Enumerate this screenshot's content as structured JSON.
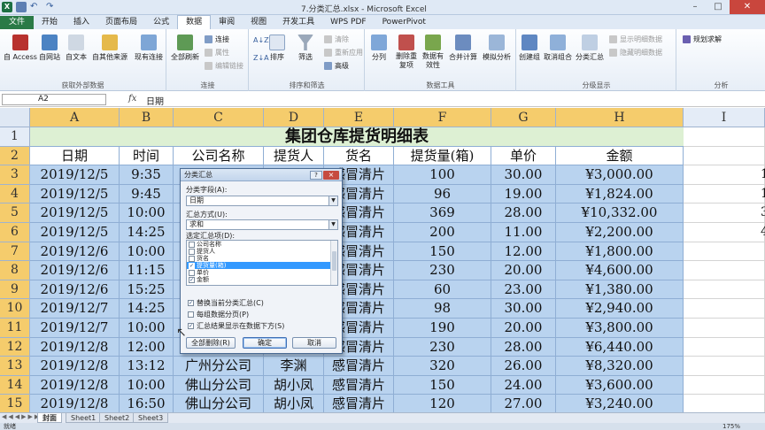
{
  "window": {
    "title": "7.分类汇总.xlsx - Microsoft Excel",
    "file_tab": "文件",
    "tabs": [
      "开始",
      "插入",
      "页面布局",
      "公式",
      "数据",
      "审阅",
      "视图",
      "开发工具",
      "WPS PDF",
      "PowerPivot"
    ],
    "active_tab": "数据"
  },
  "ribbon": {
    "groups": {
      "external": {
        "label": "获取外部数据",
        "access": "自 Access",
        "web": "自网站",
        "text": "自文本",
        "other": "自其他来源",
        "existing": "现有连接"
      },
      "connections": {
        "label": "连接",
        "refresh": "全部刷新",
        "conn": "连接",
        "props": "属性",
        "editlinks": "编辑链接"
      },
      "sort": {
        "label": "排序和筛选",
        "sort": "排序",
        "filter": "筛选",
        "clear": "清除",
        "reapply": "重新应用",
        "advanced": "高级"
      },
      "tools": {
        "label": "数据工具",
        "split": "分列",
        "dedupe": "删除重复项",
        "validate": "数据有效性",
        "consolidate": "合并计算",
        "whatif": "模拟分析"
      },
      "outline": {
        "label": "分级显示",
        "group": "创建组",
        "ungroup": "取消组合",
        "subtotal": "分类汇总",
        "show": "显示明细数据",
        "hide": "隐藏明细数据"
      },
      "analysis": {
        "label": "分析",
        "solver": "规划求解"
      }
    }
  },
  "formula_bar": {
    "cell": "A2",
    "fx": "fx",
    "content": "日期"
  },
  "sheet": {
    "columns": [
      "A",
      "B",
      "C",
      "D",
      "E",
      "F",
      "G",
      "H",
      "I"
    ],
    "rows": [
      "1",
      "2",
      "3",
      "4",
      "5",
      "6",
      "7",
      "8",
      "9",
      "10",
      "11",
      "12",
      "13",
      "14",
      "15"
    ],
    "title": "集团仓库提货明细表",
    "headers": [
      "日期",
      "时间",
      "公司名称",
      "提货人",
      "货名",
      "提货量(箱)",
      "单价",
      "金额"
    ],
    "data": [
      [
        "2019/12/5",
        "9:35",
        "",
        "",
        "感冒清片",
        "100",
        "30.00",
        "¥3,000.00"
      ],
      [
        "2019/12/5",
        "9:45",
        "",
        "",
        "感冒清片",
        "96",
        "19.00",
        "¥1,824.00"
      ],
      [
        "2019/12/5",
        "10:00",
        "",
        "",
        "感冒清片",
        "369",
        "28.00",
        "¥10,332.00"
      ],
      [
        "2019/12/5",
        "14:25",
        "",
        "",
        "感冒清片",
        "200",
        "11.00",
        "¥2,200.00"
      ],
      [
        "2019/12/6",
        "10:00",
        "",
        "",
        "感冒清片",
        "150",
        "12.00",
        "¥1,800.00"
      ],
      [
        "2019/12/6",
        "11:15",
        "",
        "",
        "感冒清片",
        "230",
        "20.00",
        "¥4,600.00"
      ],
      [
        "2019/12/6",
        "15:25",
        "",
        "",
        "感冒清片",
        "60",
        "23.00",
        "¥1,380.00"
      ],
      [
        "2019/12/7",
        "14:25",
        "",
        "",
        "感冒清片",
        "98",
        "30.00",
        "¥2,940.00"
      ],
      [
        "2019/12/7",
        "10:00",
        "",
        "",
        "感冒清片",
        "190",
        "20.00",
        "¥3,800.00"
      ],
      [
        "2019/12/8",
        "12:00",
        "",
        "",
        "感冒清片",
        "230",
        "28.00",
        "¥6,440.00"
      ],
      [
        "2019/12/8",
        "13:12",
        "广州分公司",
        "李渊",
        "感冒清片",
        "320",
        "26.00",
        "¥8,320.00"
      ],
      [
        "2019/12/8",
        "10:00",
        "佛山分公司",
        "胡小凤",
        "感冒清片",
        "150",
        "24.00",
        "¥3,600.00"
      ],
      [
        "2019/12/8",
        "16:50",
        "佛山分公司",
        "胡小凤",
        "感冒清片",
        "120",
        "27.00",
        "¥3,240.00"
      ]
    ],
    "right_edge_digits": [
      "1",
      "1",
      "3",
      "4"
    ]
  },
  "sheet_tabs": [
    "封面",
    "Sheet1",
    "Sheet2",
    "Sheet3"
  ],
  "status": {
    "ready": "就绪",
    "zoom": "175%"
  },
  "dialog": {
    "title": "分类汇总",
    "help": "?",
    "close": "×",
    "field_label": "分类字段(A):",
    "field_value": "日期",
    "func_label": "汇总方式(U):",
    "func_value": "求和",
    "items_label": "选定汇总项(D):",
    "items": [
      {
        "label": "公司名称",
        "checked": false,
        "selected": false
      },
      {
        "label": "提货人",
        "checked": false,
        "selected": false
      },
      {
        "label": "货名",
        "checked": false,
        "selected": false
      },
      {
        "label": "提货量(箱)",
        "checked": true,
        "selected": true
      },
      {
        "label": "单价",
        "checked": false,
        "selected": false
      },
      {
        "label": "金额",
        "checked": true,
        "selected": false
      }
    ],
    "opt_replace": "替换当前分类汇总(C)",
    "opt_pagebreak": "每组数据分页(P)",
    "opt_below": "汇总结果显示在数据下方(S)",
    "btn_remove": "全部删除(R)",
    "btn_ok": "确定",
    "btn_cancel": "取消"
  }
}
